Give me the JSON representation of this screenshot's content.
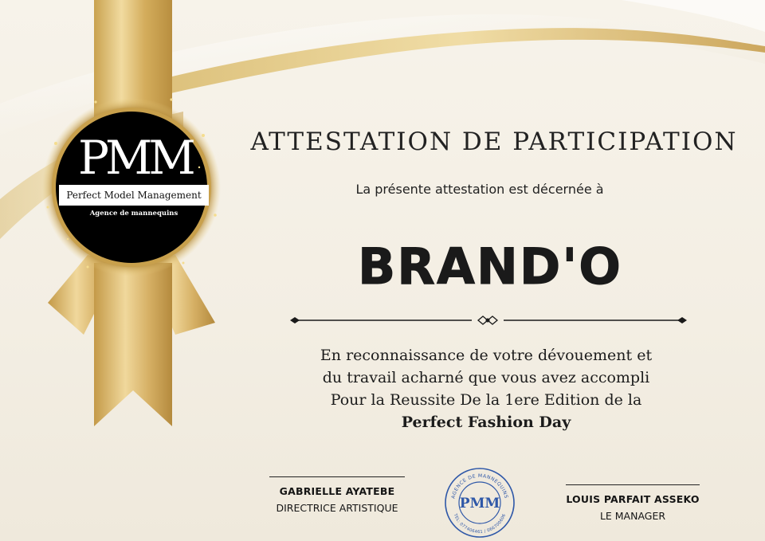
{
  "certificate": {
    "title": "ATTESTATION DE PARTICIPATION",
    "intro": "La présente attestation est décernée à",
    "recipient": "BRAND'O",
    "body_lines": [
      "En reconnaissance de votre dévouement et",
      "du travail acharné que vous avez accompli",
      "Pour la Reussite De la 1ere Edition de la",
      "Perfect Fashion Day"
    ]
  },
  "seal": {
    "monogram": "PMM",
    "name": "Perfect Model Management",
    "subtitle": "Agence de mannequins"
  },
  "signatures": {
    "left": {
      "name": "GABRIELLE AYATEBE",
      "role": "DIRECTRICE ARTISTIQUE"
    },
    "right": {
      "name": "LOUIS PARFAIT ASSEKO",
      "role": "LE MANAGER"
    }
  },
  "stamp": {
    "center": "PMM",
    "ring_top": "AGENCE DE MANNEQUINS",
    "ring_bottom": "TEL: 077406461 / 066700606"
  },
  "colors": {
    "gold": "#d4ad5c",
    "gold_light": "#f1dba0",
    "ink": "#1a1a1a",
    "stamp_blue": "#2f58a8",
    "background": "#f4efe4"
  }
}
